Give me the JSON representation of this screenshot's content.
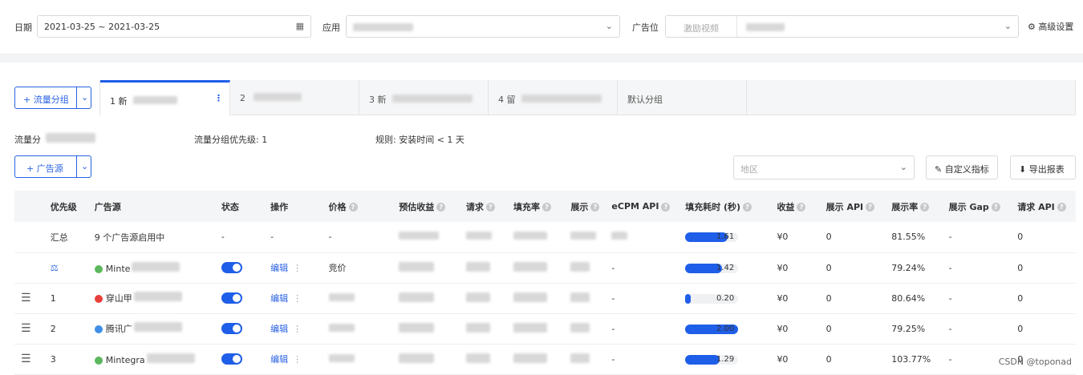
{
  "filters": {
    "date_label": "日期",
    "date_value": "2021-03-25 ~ 2021-03-25",
    "app_label": "应用",
    "adslot_label": "广告位",
    "adslot_type": "激励视频",
    "advanced": "高级设置"
  },
  "groups": {
    "add_button": "+ 流量分组",
    "tabs": [
      "1 新",
      "2",
      "3 新",
      "4 留",
      "默认分组"
    ],
    "info_name_label": "流量分",
    "priority_label": "流量分组优先级: 1",
    "rule_label": "规则: 安装时间 < 1 天"
  },
  "toolbar": {
    "add_source": "+ 广告源",
    "region_placeholder": "地区",
    "custom_metrics": "自定义指标",
    "export": "导出报表"
  },
  "table": {
    "headers": [
      "优先级",
      "广告源",
      "状态",
      "操作",
      "价格",
      "预估收益",
      "请求",
      "填充率",
      "展示",
      "eCPM API",
      "填充耗时 (秒)",
      "收益",
      "展示 API",
      "展示率",
      "展示 Gap",
      "请求 API"
    ],
    "summary": {
      "priority": "汇总",
      "source": "9 个广告源启用中",
      "status": "-",
      "op": "-",
      "price": "-",
      "fill_time": "1.61",
      "fill_ratio": 0.8,
      "revenue": "¥0",
      "show_api": "0",
      "show_rate": "81.55%",
      "gap": "-",
      "req_api": "0"
    },
    "rows": [
      {
        "priority": "",
        "source": "Minte",
        "price": "竞价",
        "ecpm": "-",
        "fill_time": "1.42",
        "fill_ratio": 0.7,
        "revenue": "¥0",
        "show_api": "0",
        "show_rate": "79.24%",
        "gap": "-",
        "req_api": "0",
        "edit": "编辑",
        "logo_color": "#5bb85d"
      },
      {
        "priority": "1",
        "source": "穿山甲",
        "price": "",
        "ecpm": "-",
        "fill_time": "0.20",
        "fill_ratio": 0.1,
        "revenue": "¥0",
        "show_api": "0",
        "show_rate": "80.64%",
        "gap": "-",
        "req_api": "0",
        "edit": "编辑",
        "logo_color": "#e8413c"
      },
      {
        "priority": "2",
        "source": "腾讯广",
        "price": "",
        "ecpm": "-",
        "fill_time": "2.00",
        "fill_ratio": 1.0,
        "revenue": "¥0",
        "show_api": "0",
        "show_rate": "79.25%",
        "gap": "-",
        "req_api": "0",
        "edit": "编辑",
        "logo_color": "#3f8ee8"
      },
      {
        "priority": "3",
        "source": "Mintegra",
        "price": "",
        "ecpm": "-",
        "fill_time": "1.29",
        "fill_ratio": 0.65,
        "revenue": "¥0",
        "show_api": "0",
        "show_rate": "103.77%",
        "gap": "-",
        "req_api": "0",
        "edit": "编辑",
        "logo_color": "#5bb85d"
      }
    ]
  },
  "watermark": "CSDN @toponad",
  "colors": {
    "accent": "#1f5ee8"
  }
}
